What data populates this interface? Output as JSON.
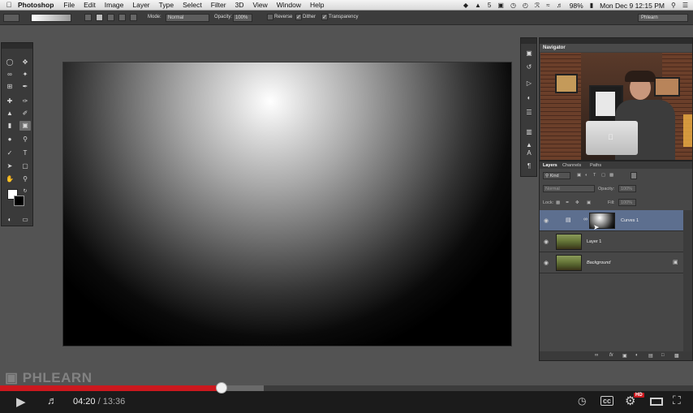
{
  "menubar": {
    "app_name": "Photoshop",
    "menus": [
      "File",
      "Edit",
      "Image",
      "Layer",
      "Type",
      "Select",
      "Filter",
      "3D",
      "View",
      "Window",
      "Help"
    ],
    "badge": "5",
    "battery": "98%",
    "clock": "Mon Dec 9  12:15 PM"
  },
  "options": {
    "mode_label": "Mode:",
    "mode_value": "Normal",
    "opacity_label": "Opacity:",
    "opacity_value": "100%",
    "reverse_label": "Reverse",
    "dither_label": "Dither",
    "transparency_label": "Transparency",
    "workspace": "Phlearn"
  },
  "navigator": {
    "title": "Navigator"
  },
  "layers_panel": {
    "tabs": [
      "Layers",
      "Channels",
      "Paths"
    ],
    "filter_kind": "Kind",
    "blend_mode": "Normal",
    "opacity_label": "Opacity:",
    "opacity_value": "100%",
    "lock_label": "Lock:",
    "fill_label": "Fill:",
    "fill_value": "100%",
    "layers": [
      {
        "name": "Curves 1",
        "selected": true
      },
      {
        "name": "Layer 1",
        "selected": false
      },
      {
        "name": "Background",
        "selected": false
      }
    ]
  },
  "watermark": "PHLEARN",
  "player": {
    "current_time": "04:20",
    "separator": "/",
    "duration": "13:36",
    "played_fraction": 0.32,
    "hd_badge": "HD"
  }
}
